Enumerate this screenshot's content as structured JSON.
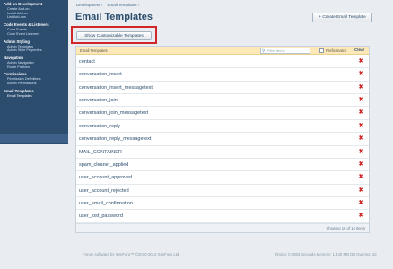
{
  "sidebar": {
    "groups": [
      {
        "title": "Add-on Development",
        "items": [
          "Create Add-on",
          "Install Add-on",
          "List Add-ons"
        ]
      },
      {
        "title": "Code Events & Listeners",
        "items": [
          "Code Events",
          "Code Event Listeners"
        ]
      },
      {
        "title": "Admin Styling",
        "items": [
          "Admin Templates",
          "Admin Style Properties"
        ]
      },
      {
        "title": "Navigation",
        "items": [
          "Admin Navigation",
          "Route Prefixes"
        ]
      },
      {
        "title": "Permissions",
        "items": [
          "Permission Definitions",
          "Admin Permissions"
        ]
      },
      {
        "title": "Email Templates",
        "items": [
          "Email Templates"
        ]
      }
    ]
  },
  "breadcrumb": {
    "items": [
      "Development ›",
      "Email Templates ›"
    ]
  },
  "page": {
    "title": "Email Templates",
    "create_button": "+ Create Email Template",
    "customizable_button": "Show Customizable Templates"
  },
  "panel": {
    "header_label": "Email Templates",
    "filter_placeholder": "Filter items",
    "prefix_label": "Prefix match",
    "clear_label": "Clear",
    "rows": [
      "contact",
      "conversation_insert",
      "conversation_insert_messagetext",
      "conversation_join",
      "conversation_join_messagetext",
      "conversation_reply",
      "conversation_reply_messagetext",
      "MAIL_CONTAINER",
      "spam_cleaner_applied",
      "user_account_approved",
      "user_account_rejected",
      "user_email_confirmation",
      "user_lost_password"
    ],
    "delete_glyph": "✖",
    "showing": "Showing 16 of 16 items"
  },
  "footer": {
    "copyright": "Forum software by XenForo™ ©2010-2012 XenForo Ltd.",
    "timing": "Timing: 0.0863 seconds Memory: 1.440 MB DB Queries: 10"
  }
}
